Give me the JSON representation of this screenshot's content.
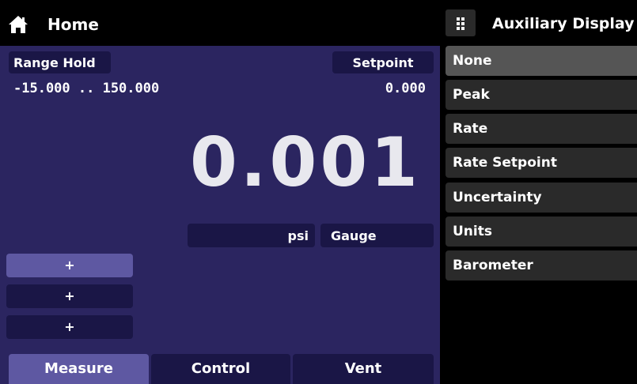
{
  "header": {
    "title": "Home",
    "home_icon": "home-icon"
  },
  "aux_header": {
    "title": "Auxiliary Display",
    "menu_icon": "grid-menu-icon"
  },
  "range": {
    "label": "Range Hold",
    "value": "-15.000 .. 150.000"
  },
  "setpoint": {
    "label": "Setpoint",
    "value": "0.000"
  },
  "reading": {
    "value": "0.001",
    "unit": "psi",
    "mode": "Gauge"
  },
  "quick_buttons": [
    "+",
    "+",
    "+"
  ],
  "tabs": [
    {
      "label": "Measure",
      "active": true
    },
    {
      "label": "Control",
      "active": false
    },
    {
      "label": "Vent",
      "active": false
    }
  ],
  "aux_options": [
    {
      "label": "None",
      "selected": true
    },
    {
      "label": "Peak",
      "selected": false
    },
    {
      "label": "Rate",
      "selected": false
    },
    {
      "label": "Rate Setpoint",
      "selected": false
    },
    {
      "label": "Uncertainty",
      "selected": false
    },
    {
      "label": "Units",
      "selected": false
    },
    {
      "label": "Barometer",
      "selected": false
    }
  ],
  "colors": {
    "panel": "#2b2560",
    "chip": "#1a1646",
    "active": "#5e58a2",
    "aux_item": "#2a2a2a",
    "aux_selected": "#555555"
  }
}
